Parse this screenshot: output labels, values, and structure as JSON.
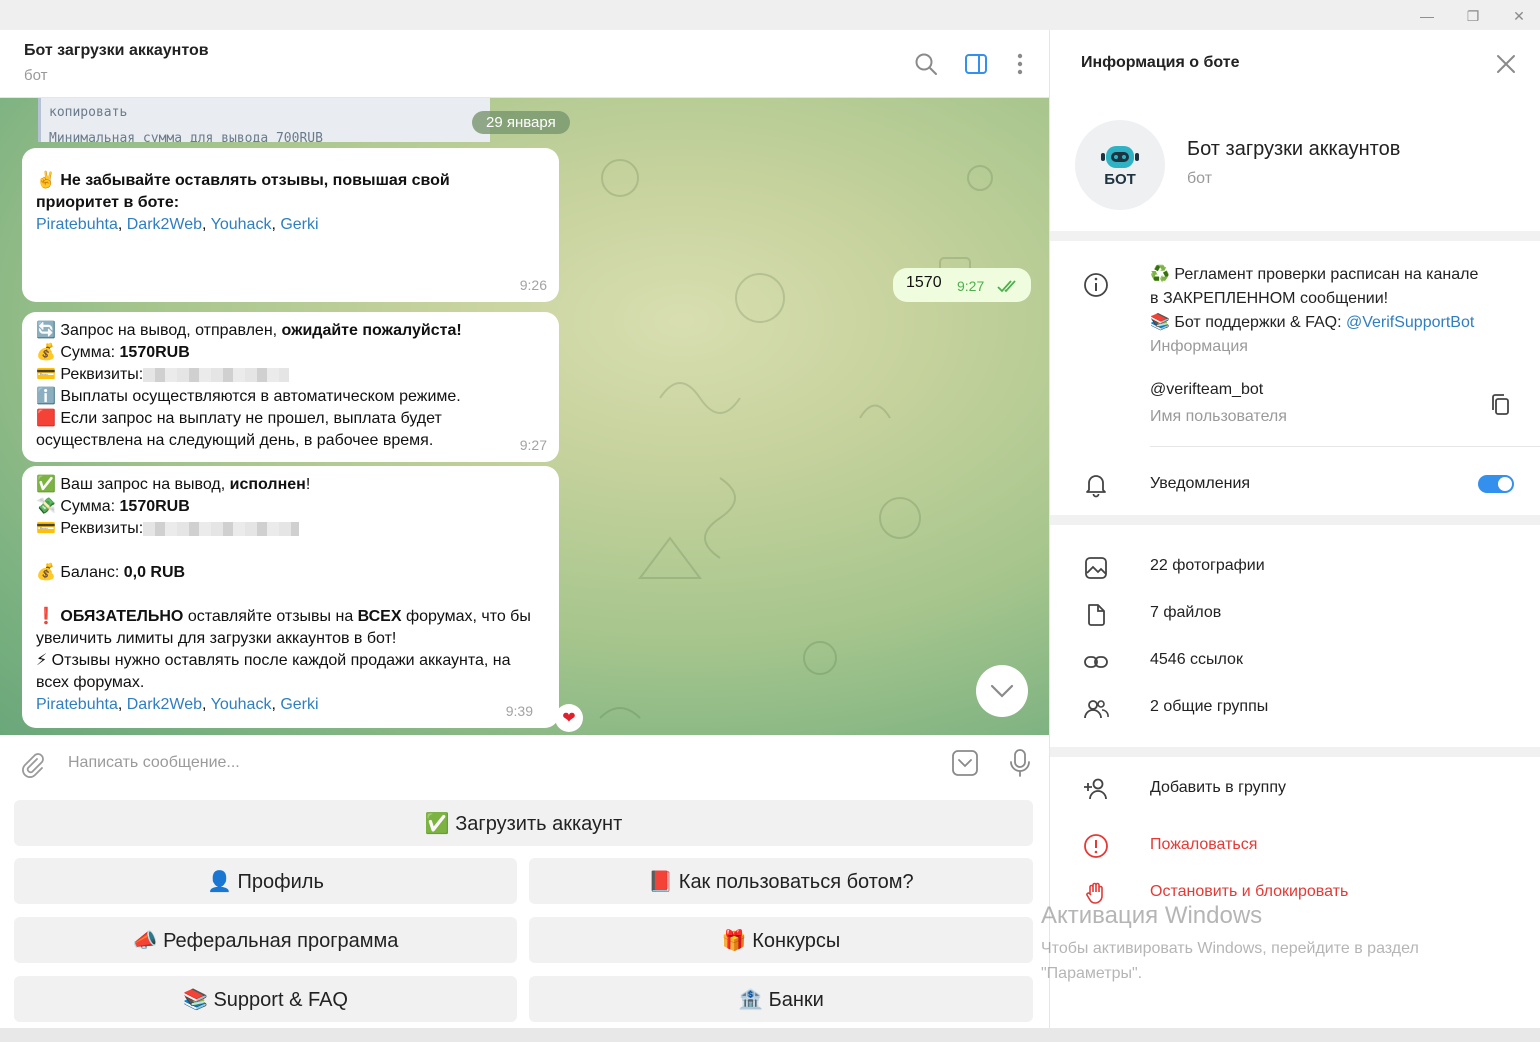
{
  "window": {
    "minimize": "—",
    "restore": "❐",
    "close": "✕"
  },
  "chat": {
    "title": "Бот загрузки аккаунтов",
    "subtitle": "бот",
    "quote_line1": "копировать",
    "quote_line2": "Минимальная сумма для вывода 700RUB",
    "date_pill": "29 января",
    "msg1": {
      "line1": "✌️ Не забывайте оставлять отзывы, повышая свой",
      "line2": "приоритет в боте:",
      "links": [
        "Piratebuhta",
        "Dark2Web",
        "Youhack",
        "Gerki"
      ],
      "time": "9:26"
    },
    "out": {
      "text": "1570",
      "time": "9:27"
    },
    "msg2": {
      "l1a": "🔄 Запрос на вывод,  отправлен, ",
      "l1b": "ожидайте пожалуйста!",
      "l2a": "💰 Сумма: ",
      "l2b": "1570RUB",
      "l3": "💳 Реквизиты:",
      "l4": "ℹ️ Выплаты осуществляются в автоматическом режиме.",
      "l5": "🟥 Если запрос на выплату не прошел, выплата будет",
      "l6": "осуществлена на следующий день, в рабочее время.",
      "time": "9:27"
    },
    "msg3": {
      "l1a": "✅ Ваш запрос на вывод, ",
      "l1b": "исполнен",
      "l1c": "!",
      "l2a": "💸 Сумма: ",
      "l2b": "1570RUB",
      "l3": "💳 Реквизиты:",
      "l4a": "💰 Баланс: ",
      "l4b": "0,0 RUB",
      "l5a": "❗ ",
      "l5b": "ОБЯЗАТЕЛЬНО",
      "l5c": " оставляйте отзывы на ",
      "l5d": "ВСЕХ",
      "l5e": " форумах, что бы",
      "l6": "увеличить лимиты для загрузки аккаунтов в бот!",
      "l7": "⚡ Отзывы нужно оставлять после каждой продажи аккаунта, на",
      "l8": "всех форумах.",
      "links": [
        "Piratebuhta",
        "Dark2Web",
        "Youhack",
        "Gerki"
      ],
      "time": "9:39"
    },
    "composer_placeholder": "Написать сообщение..."
  },
  "keyboard": {
    "upload": "✅ Загрузить аккаунт",
    "profile": "👤 Профиль",
    "howto": "📕 Как пользоваться ботом?",
    "referral": "📣 Реферальная программа",
    "contests": "🎁 Конкурсы",
    "support": "📚 Support & FAQ",
    "banks": "🏦 Банки"
  },
  "panel": {
    "title": "Информация о боте",
    "avatar_text": "БОТ",
    "name": "Бот загрузки аккаунтов",
    "subtitle": "бот",
    "info_line1": "♻️ Регламент проверки расписан на канале",
    "info_line2": "в ЗАКРЕПЛЕННОМ сообщении!",
    "info_line3a": "📚 Бот поддержки & FAQ: ",
    "info_line3b": "@VerifSupportBot",
    "info_label": "Информация",
    "username": "@verifteam_bot",
    "username_label": "Имя пользователя",
    "notifications": "Уведомления",
    "photos": "22 фотографии",
    "files": "7 файлов",
    "links": "4546 ссылок",
    "groups": "2 общие группы",
    "add_group": "Добавить в группу",
    "report": "Пожаловаться",
    "block": "Остановить и блокировать"
  },
  "watermark": {
    "title": "Активация Windows",
    "line1": "Чтобы активировать Windows, перейдите в раздел",
    "line2": "\"Параметры\"."
  },
  "colors": {
    "accent": "#3390ec",
    "link": "#2f7ec1",
    "danger": "#e53935",
    "outgoing": "#effdde"
  }
}
